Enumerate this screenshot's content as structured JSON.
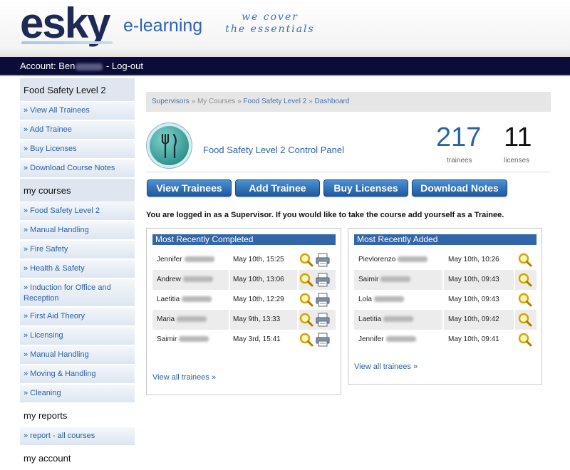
{
  "header": {
    "logo": "esky",
    "product": "e-learning",
    "tagline_line1": "we cover",
    "tagline_line2": "the essentials"
  },
  "account_bar": {
    "prefix": "Account: Ben",
    "logout": " - Log-out"
  },
  "sidebar": {
    "section1_heading": "Food Safety Level 2",
    "section1_items": [
      "» View All Trainees",
      "» Add Trainee",
      "» Buy Licenses",
      "» Download Course Notes"
    ],
    "section2_heading": "my courses",
    "section2_items": [
      "» Food Safety Level 2",
      "» Manual Handling",
      "» Fire Safety",
      "» Health & Safety",
      "» Induction for Office and Reception",
      "» First Aid Theory",
      "» Licensing",
      "» Manual Handling",
      "» Moving & Handling",
      "» Cleaning"
    ],
    "section3_heading": "my reports",
    "section3_items": [
      "» report - all courses"
    ],
    "section4_heading": "my account"
  },
  "breadcrumb": {
    "items": [
      "Supervisors",
      "My Courses",
      "Food Safety Level 2",
      "Dashboard"
    ],
    "separator": " » "
  },
  "panel": {
    "title": "Food Safety Level 2 Control Panel",
    "trainees_count": "217",
    "trainees_label": "trainees",
    "licenses_count": "11",
    "licenses_label": "licenses"
  },
  "buttons": {
    "view_trainees": "View Trainees",
    "add_trainee": "Add Trainee",
    "buy_licenses": "Buy Licenses",
    "download_notes": "Download Notes"
  },
  "notice": "You are logged in as a Supervisor. If you would like to take the course add yourself as a Trainee.",
  "completed": {
    "title": "Most Recently Completed",
    "rows": [
      {
        "name": "Jennifer",
        "date": "May 10th, 15:25"
      },
      {
        "name": "Andrew",
        "date": "May 10th, 13:06"
      },
      {
        "name": "Laetitia",
        "date": "May 10th, 12:29"
      },
      {
        "name": "Maria",
        "date": "May 9th, 13:33"
      },
      {
        "name": "Saimir",
        "date": "May 3rd, 15:41"
      }
    ],
    "view_all": "View all trainees »"
  },
  "added": {
    "title": "Most Recently Added",
    "rows": [
      {
        "name": "Pievlorenzo",
        "date": "May 10th, 10:26"
      },
      {
        "name": "Saimir",
        "date": "May 10th, 09:43"
      },
      {
        "name": "Lola",
        "date": "May 10th, 09:43"
      },
      {
        "name": "Laetitia",
        "date": "May 10th, 09:42"
      },
      {
        "name": "Jennifer",
        "date": "May 10th, 09:41"
      }
    ],
    "view_all": "View all trainees »"
  },
  "colors": {
    "nav_dark": "#0b0c38",
    "accent_blue": "#2c5fa8",
    "button_blue": "#1e5aa0",
    "box_title": "#3266a8"
  },
  "icons": {
    "view": "magnifier-icon",
    "print": "printer-icon",
    "panel": "cutlery-icon"
  }
}
